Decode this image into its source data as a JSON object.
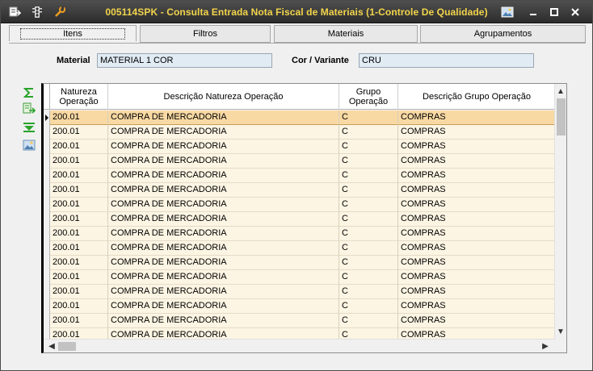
{
  "window": {
    "title": "005114SPK - Consulta Entrada Nota Fiscal de Materiais (1-Controle De Qualidade)",
    "accent": "#f2d44a"
  },
  "tabs": [
    {
      "label": "Itens",
      "active": true
    },
    {
      "label": "Filtros",
      "active": false
    },
    {
      "label": "Materiais",
      "active": false
    },
    {
      "label": "Agrupamentos",
      "active": false
    }
  ],
  "fields": {
    "material_label": "Material",
    "material_value": "MATERIAL 1 COR",
    "cor_label": "Cor / Variante",
    "cor_value": "CRU"
  },
  "toolbar_icons": [
    "sigma-icon",
    "export-icon",
    "filter-down-icon",
    "image-icon"
  ],
  "grid": {
    "columns": [
      "Natureza\nOperação",
      "Descrição Natureza Operação",
      "Grupo\nOperação",
      "Descrição Grupo Operação"
    ],
    "rows": [
      [
        "200.01",
        "COMPRA DE MERCADORIA",
        "C",
        "COMPRAS"
      ],
      [
        "200.01",
        "COMPRA DE MERCADORIA",
        "C",
        "COMPRAS"
      ],
      [
        "200.01",
        "COMPRA DE MERCADORIA",
        "C",
        "COMPRAS"
      ],
      [
        "200.01",
        "COMPRA DE MERCADORIA",
        "C",
        "COMPRAS"
      ],
      [
        "200.01",
        "COMPRA DE MERCADORIA",
        "C",
        "COMPRAS"
      ],
      [
        "200.01",
        "COMPRA DE MERCADORIA",
        "C",
        "COMPRAS"
      ],
      [
        "200.01",
        "COMPRA DE MERCADORIA",
        "C",
        "COMPRAS"
      ],
      [
        "200.01",
        "COMPRA DE MERCADORIA",
        "C",
        "COMPRAS"
      ],
      [
        "200.01",
        "COMPRA DE MERCADORIA",
        "C",
        "COMPRAS"
      ],
      [
        "200.01",
        "COMPRA DE MERCADORIA",
        "C",
        "COMPRAS"
      ],
      [
        "200.01",
        "COMPRA DE MERCADORIA",
        "C",
        "COMPRAS"
      ],
      [
        "200.01",
        "COMPRA DE MERCADORIA",
        "C",
        "COMPRAS"
      ],
      [
        "200.01",
        "COMPRA DE MERCADORIA",
        "C",
        "COMPRAS"
      ],
      [
        "200.01",
        "COMPRA DE MERCADORIA",
        "C",
        "COMPRAS"
      ],
      [
        "200.01",
        "COMPRA DE MERCADORIA",
        "C",
        "COMPRAS"
      ],
      [
        "200.01",
        "COMPRA DE MERCADORIA",
        "C",
        "COMPRAS"
      ]
    ],
    "selected_row": 0
  }
}
